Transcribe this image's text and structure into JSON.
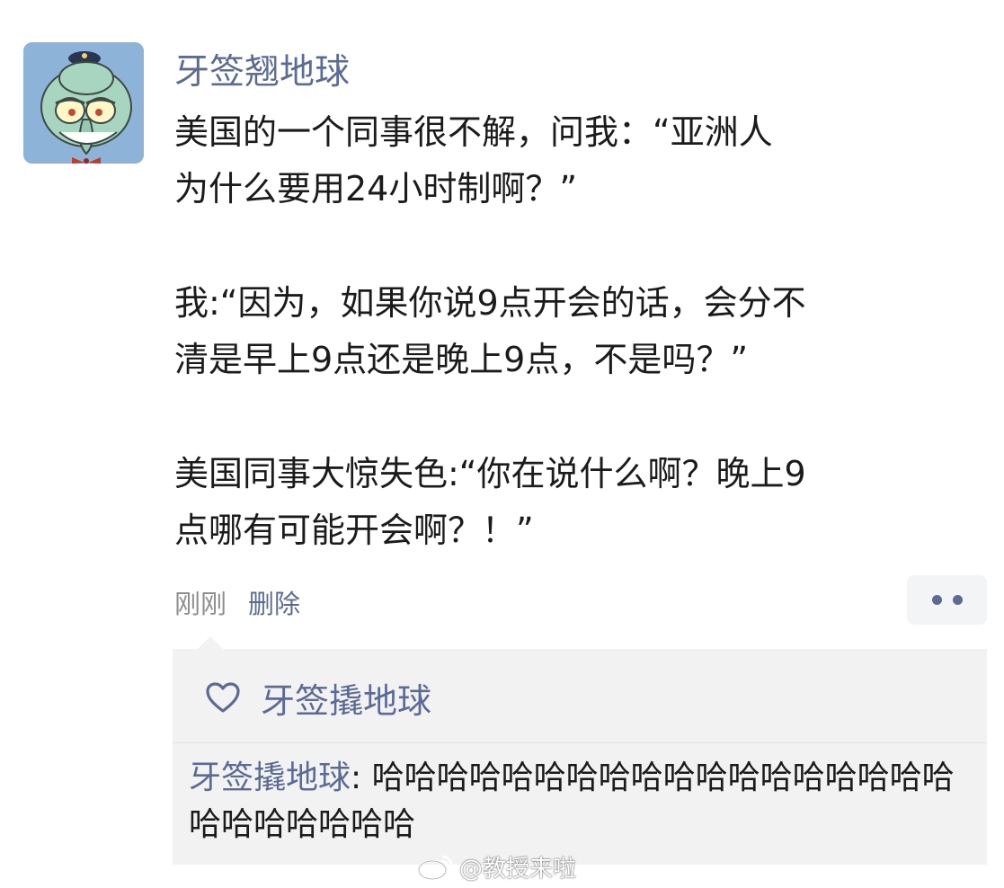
{
  "post": {
    "username": "牙签翘地球",
    "lines": [
      "美国的一个同事很不解，问我：“亚洲人",
      "为什么要用24小时制啊？”",
      "",
      "我:“因为，如果你说9点开会的话，会分不",
      "清是早上9点还是晚上9点，不是吗？”",
      "",
      "美国同事大惊失色:“你在说什么啊？晚上9",
      "点哪有可能开会啊？！”"
    ],
    "time": "刚刚",
    "delete_label": "删除"
  },
  "likes": {
    "icon": "heart-icon",
    "names": "牙签撬地球"
  },
  "comment": {
    "author": "牙签撬地球",
    "separator": ": ",
    "text": "哈哈哈哈哈哈哈哈哈哈哈哈哈哈哈哈哈哈哈哈哈哈哈哈哈"
  },
  "watermark": {
    "icon": "weibo-icon",
    "text": "@教授来啦"
  },
  "colors": {
    "link": "#5c6b93",
    "text": "#1b1b1b",
    "muted": "#8e8e8e",
    "comment_bg": "#f2f2f3",
    "avatar_bg": "#8db4d8"
  }
}
